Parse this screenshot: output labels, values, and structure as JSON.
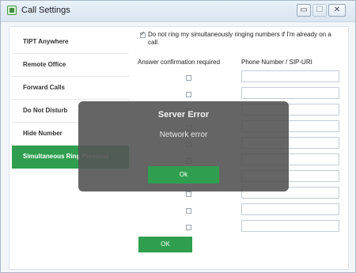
{
  "window": {
    "title": "Call Settings"
  },
  "sidebar": {
    "items": [
      {
        "label": "TIPT Anywhere",
        "active": false
      },
      {
        "label": "Remote Office",
        "active": false
      },
      {
        "label": "Forward Calls",
        "active": false
      },
      {
        "label": "Do Not Disturb",
        "active": false
      },
      {
        "label": "Hide Number",
        "active": false
      },
      {
        "label": "Simultaneous Ring Personal",
        "active": true
      }
    ]
  },
  "main": {
    "dont_ring_checkbox": {
      "label": "Do not ring my simultaneously ringing numbers if I'm already on a call.",
      "checked": true
    },
    "col_answer_confirmation": "Answer confirmation required",
    "col_phone_number": "Phone Number / SIP-URI",
    "rows": [
      {
        "confirm": false,
        "phone": ""
      },
      {
        "confirm": false,
        "phone": ""
      },
      {
        "confirm": false,
        "phone": ""
      },
      {
        "confirm": false,
        "phone": ""
      },
      {
        "confirm": false,
        "phone": ""
      },
      {
        "confirm": false,
        "phone": ""
      },
      {
        "confirm": false,
        "phone": ""
      },
      {
        "confirm": false,
        "phone": ""
      },
      {
        "confirm": false,
        "phone": ""
      },
      {
        "confirm": false,
        "phone": ""
      }
    ],
    "ok_label": "OK"
  },
  "error_dialog": {
    "title": "Server Error",
    "message": "Network error",
    "ok_label": "Ok"
  },
  "colors": {
    "accent_green": "#2f9f4f",
    "dialog_bg": "#545454"
  }
}
